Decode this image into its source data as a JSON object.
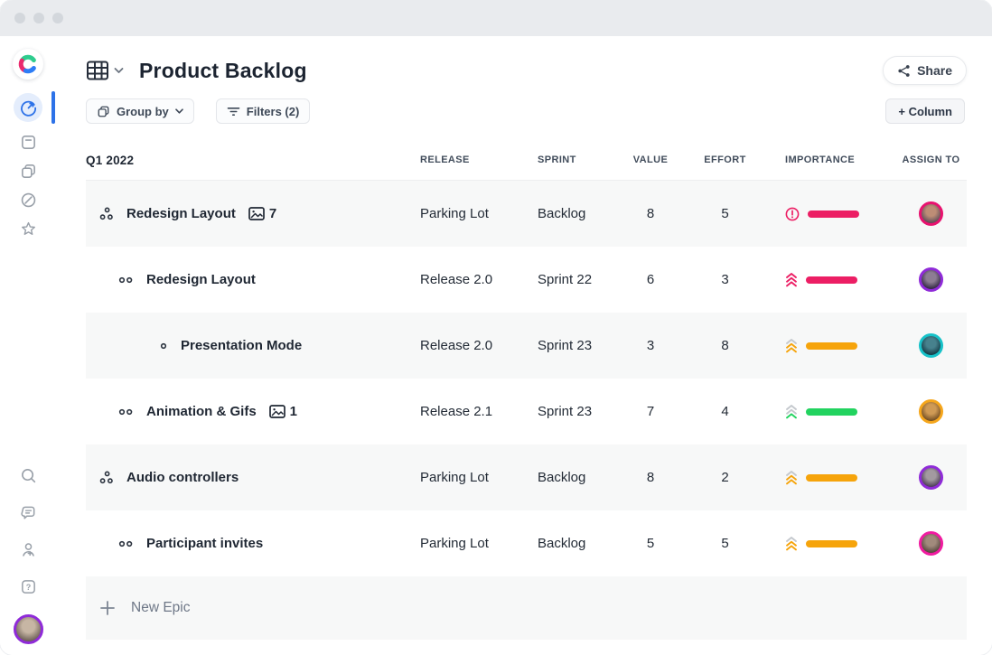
{
  "header": {
    "title": "Product Backlog",
    "share_label": "Share",
    "group_by_label": "Group by",
    "filters_label": "Filters (2)",
    "add_column_label": "+ Column"
  },
  "colors": {
    "accent_blue": "#2D72E8",
    "logo_green": "#2ECC8E",
    "logo_pink": "#EB2A6E",
    "logo_blue": "#2D7DF6",
    "importance_red": "#EC1E64",
    "importance_orange": "#F6A40B",
    "importance_green": "#22D35F",
    "chevron_gray": "#C4C8CD"
  },
  "table": {
    "group_label": "Q1 2022",
    "columns": [
      "RELEASE",
      "SPRINT",
      "VALUE",
      "EFFORT",
      "IMPORTANCE",
      "ASSIGN TO"
    ],
    "new_epic_label": "New Epic",
    "rows": [
      {
        "name": "Redesign Layout",
        "level": "epic",
        "attachments": "7",
        "release": "Parking Lot",
        "sprint": "Backlog",
        "value": "8",
        "effort": "5",
        "importance": {
          "type": "alert",
          "icon_color": "#EC1E64",
          "bar": "#EC1E64"
        },
        "avatar": {
          "ring": "#E8126F",
          "fill1": "#bd8d76",
          "fill2": "#5c4a58"
        }
      },
      {
        "name": "Redesign Layout",
        "level": "story",
        "attachments": "",
        "release": "Release 2.0",
        "sprint": "Sprint 22",
        "value": "6",
        "effort": "3",
        "importance": {
          "type": "chevrons",
          "chevrons": [
            "#EC1E64",
            "#EC1E64",
            "#EC1E64"
          ],
          "bar": "#EC1E64"
        },
        "avatar": {
          "ring": "#8F2BD8",
          "fill1": "#8d7d93",
          "fill2": "#2e2440"
        }
      },
      {
        "name": "Presentation Mode",
        "level": "substory",
        "attachments": "",
        "release": "Release 2.0",
        "sprint": "Sprint 23",
        "value": "3",
        "effort": "8",
        "importance": {
          "type": "chevrons",
          "chevrons": [
            "#C4C8CD",
            "#F6A40B",
            "#F6A40B"
          ],
          "bar": "#F6A40B"
        },
        "avatar": {
          "ring": "#17C2C9",
          "fill1": "#47818d",
          "fill2": "#123843"
        }
      },
      {
        "name": "Animation & Gifs",
        "level": "story",
        "attachments": "1",
        "release": "Release 2.1",
        "sprint": "Sprint 23",
        "value": "7",
        "effort": "4",
        "importance": {
          "type": "chevrons",
          "chevrons": [
            "#C4C8CD",
            "#C4C8CD",
            "#22D35F"
          ],
          "bar": "#22D35F"
        },
        "avatar": {
          "ring": "#F5A61C",
          "fill1": "#cf9a55",
          "fill2": "#6e4a20"
        }
      },
      {
        "name": "Audio controllers",
        "level": "epic",
        "attachments": "",
        "release": "Parking Lot",
        "sprint": "Backlog",
        "value": "8",
        "effort": "2",
        "importance": {
          "type": "chevrons",
          "chevrons": [
            "#C4C8CD",
            "#F6A40B",
            "#F6A40B"
          ],
          "bar": "#F6A40B"
        },
        "avatar": {
          "ring": "#8F2BD8",
          "fill1": "#a39aa0",
          "fill2": "#4a3a55"
        }
      },
      {
        "name": "Participant invites",
        "level": "story",
        "attachments": "",
        "release": "Parking Lot",
        "sprint": "Backlog",
        "value": "5",
        "effort": "5",
        "importance": {
          "type": "chevrons",
          "chevrons": [
            "#C4C8CD",
            "#F6A40B",
            "#F6A40B"
          ],
          "bar": "#F6A40B"
        },
        "avatar": {
          "ring": "#F01BA0",
          "fill1": "#a18a7c",
          "fill2": "#54443c"
        }
      }
    ]
  }
}
